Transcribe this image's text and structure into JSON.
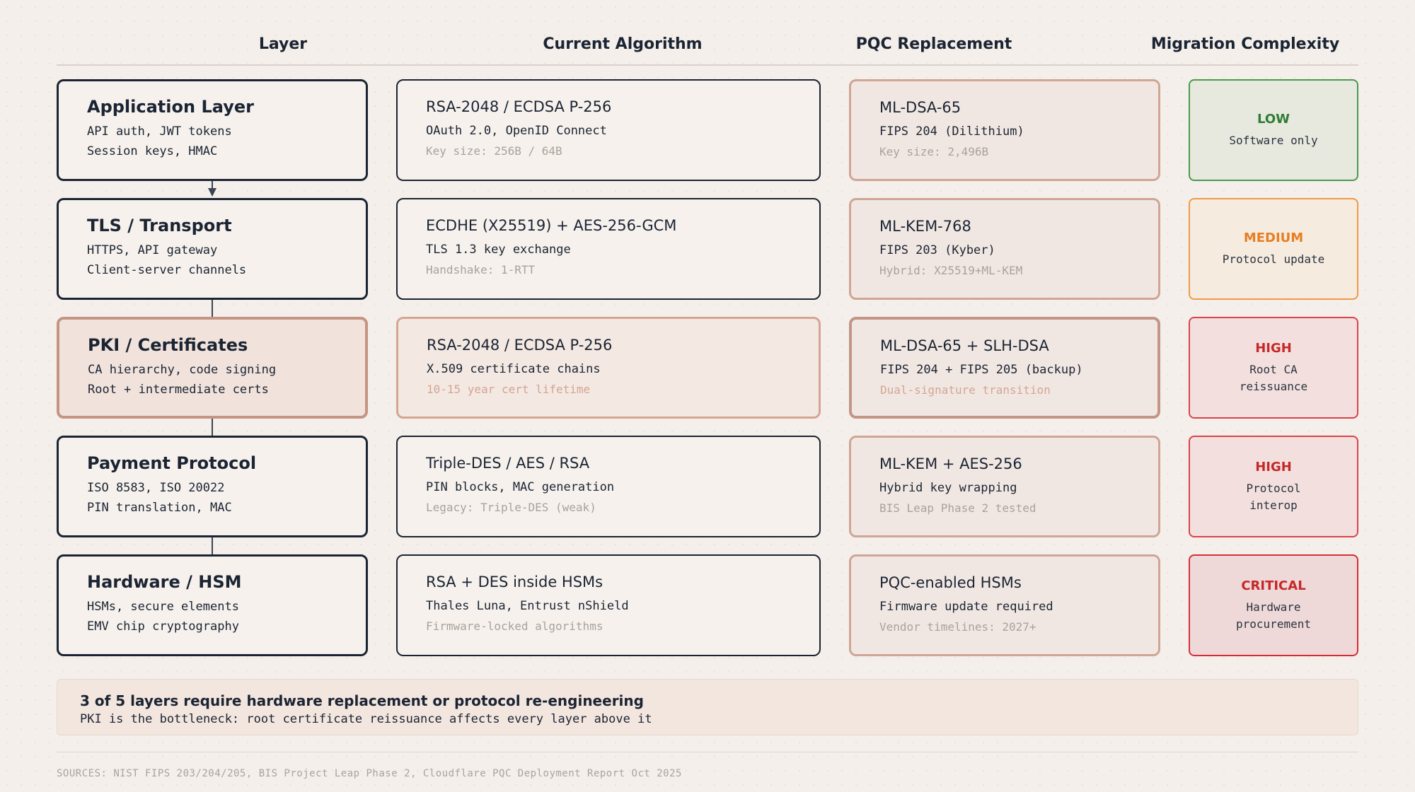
{
  "headers": {
    "layer": "Layer",
    "current": "Current Algorithm",
    "pqc": "PQC Replacement",
    "complexity": "Migration Complexity"
  },
  "rows": [
    {
      "layer": {
        "title": "Application Layer",
        "line1": "API auth, JWT tokens",
        "line2": "Session keys, HMAC"
      },
      "current": {
        "title": "RSA-2048 / ECDSA P-256",
        "line1": "OAuth 2.0, OpenID Connect",
        "line2": "Key size: 256B / 64B"
      },
      "pqc": {
        "title": "ML-DSA-65",
        "line1": "FIPS 204 (Dilithium)",
        "line2": "Key size: 2,496B"
      },
      "complexity": {
        "level": "LOW",
        "desc1": "Software only",
        "desc2": ""
      }
    },
    {
      "layer": {
        "title": "TLS / Transport",
        "line1": "HTTPS, API gateway",
        "line2": "Client-server channels"
      },
      "current": {
        "title": "ECDHE (X25519) + AES-256-GCM",
        "line1": "TLS 1.3 key exchange",
        "line2": "Handshake: 1-RTT"
      },
      "pqc": {
        "title": "ML-KEM-768",
        "line1": "FIPS 203 (Kyber)",
        "line2": "Hybrid: X25519+ML-KEM"
      },
      "complexity": {
        "level": "MEDIUM",
        "desc1": "Protocol update",
        "desc2": ""
      }
    },
    {
      "layer": {
        "title": "PKI / Certificates",
        "line1": "CA hierarchy, code signing",
        "line2": "Root + intermediate certs"
      },
      "current": {
        "title": "RSA-2048 / ECDSA P-256",
        "line1": "X.509 certificate chains",
        "line2": "10-15 year cert lifetime"
      },
      "pqc": {
        "title": "ML-DSA-65 + SLH-DSA",
        "line1": "FIPS 204 + FIPS 205 (backup)",
        "line2": "Dual-signature transition"
      },
      "complexity": {
        "level": "HIGH",
        "desc1": "Root CA",
        "desc2": "reissuance"
      }
    },
    {
      "layer": {
        "title": "Payment Protocol",
        "line1": "ISO 8583, ISO 20022",
        "line2": "PIN translation, MAC"
      },
      "current": {
        "title": "Triple-DES / AES / RSA",
        "line1": "PIN blocks, MAC generation",
        "line2": "Legacy: Triple-DES (weak)"
      },
      "pqc": {
        "title": "ML-KEM + AES-256",
        "line1": "Hybrid key wrapping",
        "line2": "BIS Leap Phase 2 tested"
      },
      "complexity": {
        "level": "HIGH",
        "desc1": "Protocol",
        "desc2": "interop"
      }
    },
    {
      "layer": {
        "title": "Hardware / HSM",
        "line1": "HSMs, secure elements",
        "line2": "EMV chip cryptography"
      },
      "current": {
        "title": "RSA + DES inside HSMs",
        "line1": "Thales Luna, Entrust nShield",
        "line2": "Firmware-locked algorithms"
      },
      "pqc": {
        "title": "PQC-enabled HSMs",
        "line1": "Firmware update required",
        "line2": "Vendor timelines: 2027+"
      },
      "complexity": {
        "level": "CRITICAL",
        "desc1": "Hardware",
        "desc2": "procurement"
      }
    }
  ],
  "colors": {
    "low": "#2e7d32",
    "medium": "#e67e22",
    "high": "#c62828",
    "critical": "#c62828"
  },
  "note": {
    "title": "3 of 5 layers require hardware replacement or protocol re-engineering",
    "subtitle": "PKI is the bottleneck: root certificate reissuance affects every layer above it"
  },
  "sources": "SOURCES: NIST FIPS 203/204/205, BIS Project Leap Phase 2, Cloudflare PQC Deployment Report Oct 2025"
}
